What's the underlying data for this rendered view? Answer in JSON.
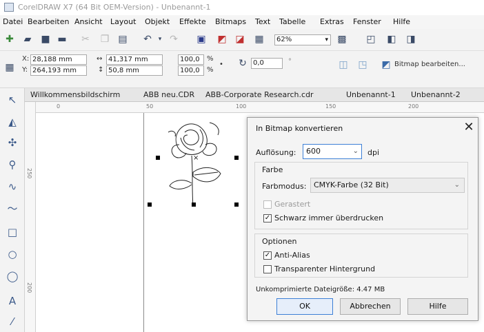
{
  "window": {
    "title": "CorelDRAW X7 (64 Bit OEM-Version) - Unbenannt-1"
  },
  "menubar": {
    "items": [
      "Datei",
      "Bearbeiten",
      "Ansicht",
      "Layout",
      "Objekt",
      "Effekte",
      "Bitmaps",
      "Text",
      "Tabelle",
      "Extras",
      "Fenster",
      "Hilfe"
    ]
  },
  "toolbar": {
    "zoom_value": "62%",
    "bitmap_edit_label": "Bitmap bearbeiten..."
  },
  "property_bar": {
    "x_label": "X:",
    "x_value": "28,188 mm",
    "y_label": "Y:",
    "y_value": "264,193 mm",
    "width_value": "41,317 mm",
    "height_value": "50,8 mm",
    "scale_x": "100,0",
    "scale_y": "100,0",
    "percent": "%",
    "rotation_value": "0,0",
    "degree": "°"
  },
  "doc_tabs": [
    "Willkommensbildschirm",
    "ABB neu.CDR",
    "ABB-Corporate Research.cdr",
    "Unbenannt-1",
    "Unbenannt-2"
  ],
  "ruler": {
    "h_unit": "%",
    "h_ticks": [
      "0",
      "50",
      "100",
      "150",
      "200"
    ],
    "v_ticks": [
      "250",
      "200"
    ]
  },
  "dialog": {
    "title": "In Bitmap konvertieren",
    "resolution_label": "Auflösung:",
    "resolution_value": "600",
    "resolution_unit": "dpi",
    "color_group_label": "Farbe",
    "color_mode_label": "Farbmodus:",
    "color_mode_value": "CMYK-Farbe (32 Bit)",
    "dithered_label": "Gerastert",
    "dithered_checked": false,
    "overprint_label": "Schwarz immer überdrucken",
    "overprint_checked": true,
    "options_group_label": "Optionen",
    "antialias_label": "Anti-Alias",
    "antialias_checked": true,
    "transparent_label": "Transparenter Hintergrund",
    "transparent_checked": false,
    "filesize_text": "Unkomprimierte Dateigröße: 4.47 MB",
    "ok_label": "OK",
    "cancel_label": "Abbrechen",
    "help_label": "Hilfe",
    "check_glyph": "✓"
  },
  "icons": {
    "close": "close-icon",
    "dropdown": "chevron-down-icon"
  },
  "colors": {
    "default_button_border": "#3c7fd6",
    "tool_icon": "#3c5a8a"
  }
}
